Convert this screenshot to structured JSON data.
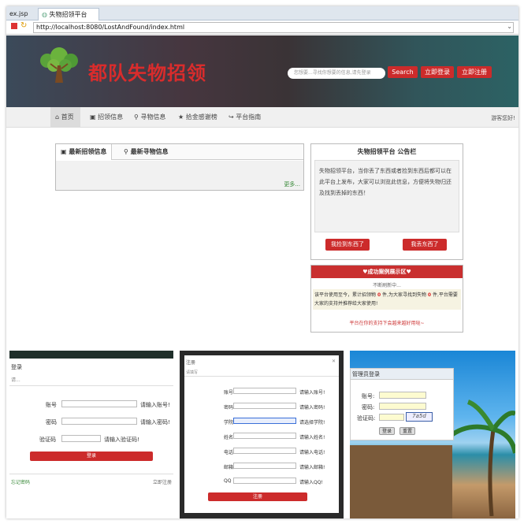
{
  "browser": {
    "tabs": [
      "ex.jsp",
      "失物招领平台"
    ],
    "url": "http://localhost:8080/LostAndFound/index.html"
  },
  "header": {
    "site_title": "都队失物招领",
    "search_placeholder": "您想要...寻找你想要的信息,请先登录",
    "search_label": "Search",
    "login_label": "立即登录",
    "register_label": "立即注册"
  },
  "nav": {
    "items": [
      "首页",
      "招领信息",
      "寻物信息",
      "拾金感谢榜",
      "平台指南"
    ],
    "right_text": "游客您好!"
  },
  "main": {
    "tabs": [
      "最新招领信息",
      "最新寻物信息"
    ],
    "more_label": "更多..."
  },
  "notice": {
    "title": "失物招领平台 公告栏",
    "body": "失物招领平台，当你丢了东西或者捡到东西后都可以在此平台上发布，大家可以浏览此信息，方便将失物归还及找到丢掉的东西！",
    "found_button": "我捡到东西了",
    "lost_button": "我丢东西了"
  },
  "success": {
    "header": "♥成功案例展示区♥",
    "subtitle": "不断刷新中...",
    "stats_prefix": "该平台使用至今，累计招领物",
    "found_count": "0",
    "stats_mid": "件,为大家寻找到失物",
    "lost_count": "0",
    "stats_suffix": "件,平台需要大家的支持并推荐给大家使用!",
    "footer": "平台在你的支持下会越来越好用哒~"
  },
  "login_shot": {
    "title": "登录",
    "sub": "请...",
    "account_label": "账号",
    "account_hint": "请输入账号!",
    "password_label": "密码",
    "password_hint": "请输入密码!",
    "captcha_label": "验证码",
    "captcha_hint": "请输入验证码!",
    "submit": "登录",
    "footer_left": "忘记密码",
    "footer_right": "立即注册"
  },
  "register_shot": {
    "title": "注册",
    "sub": "请填写",
    "fields": [
      {
        "label": "账号",
        "hint": "请输入账号!"
      },
      {
        "label": "密码",
        "hint": "请输入密码!"
      },
      {
        "label": "学院",
        "hint": "请选择学院!"
      },
      {
        "label": "姓名",
        "hint": "请输入姓名!"
      },
      {
        "label": "电话",
        "hint": "请输入电话!"
      },
      {
        "label": "邮箱",
        "hint": "请输入邮箱!"
      },
      {
        "label": "QQ",
        "hint": "请输入QQ!"
      }
    ],
    "submit": "注册"
  },
  "admin_shot": {
    "title": "管理员登录",
    "account_label": "账号:",
    "password_label": "密码:",
    "captcha_label": "验证码:",
    "captcha_text": "7a5d",
    "login_btn": "登录",
    "reset_btn": "重置"
  }
}
